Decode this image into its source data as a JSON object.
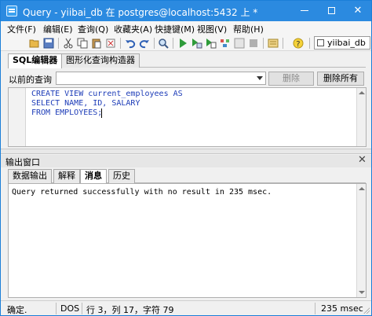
{
  "window": {
    "title": "Query - yiibai_db 在 postgres@localhost:5432 上 *",
    "accent": "#2b8ae0"
  },
  "menu": [
    {
      "label": "文件(F)"
    },
    {
      "label": "编辑(E)"
    },
    {
      "label": "查询(Q)"
    },
    {
      "label": "收藏夹(A)"
    },
    {
      "label": "快捷键(M)"
    },
    {
      "label": "视图(V)"
    },
    {
      "label": "帮助(H)"
    }
  ],
  "toolbar": {
    "database": "yiibai_db",
    "icons": [
      "open-folder-icon",
      "save-icon",
      "cut-icon",
      "copy-icon",
      "paste-icon",
      "clear-icon",
      "undo-icon",
      "redo-icon",
      "find-icon",
      "execute-icon",
      "execute-pgscript-icon",
      "explain-icon",
      "stop-icon",
      "history-icon",
      "help-icon"
    ]
  },
  "editor_tabs": [
    {
      "label": "SQL编辑器",
      "active": true
    },
    {
      "label": "图形化查询构造器",
      "active": false
    }
  ],
  "previous_query": {
    "label": "以前的查询",
    "value": "",
    "delete_label": "删除",
    "delete_all_label": "删除所有"
  },
  "editor": {
    "lines": [
      "CREATE VIEW current_employees AS",
      "SELECT NAME, ID, SALARY",
      "FROM EMPLOYEES;"
    ]
  },
  "output": {
    "title": "输出窗口",
    "tabs": [
      {
        "label": "数据输出",
        "active": false
      },
      {
        "label": "解释",
        "active": false
      },
      {
        "label": "消息",
        "active": true
      },
      {
        "label": "历史",
        "active": false
      }
    ],
    "message": "Query returned successfully with no result in 235 msec."
  },
  "status": {
    "state": "确定.",
    "line_ending": "DOS",
    "position": "行 3，列 17，字符 79",
    "time": "235 msec"
  }
}
